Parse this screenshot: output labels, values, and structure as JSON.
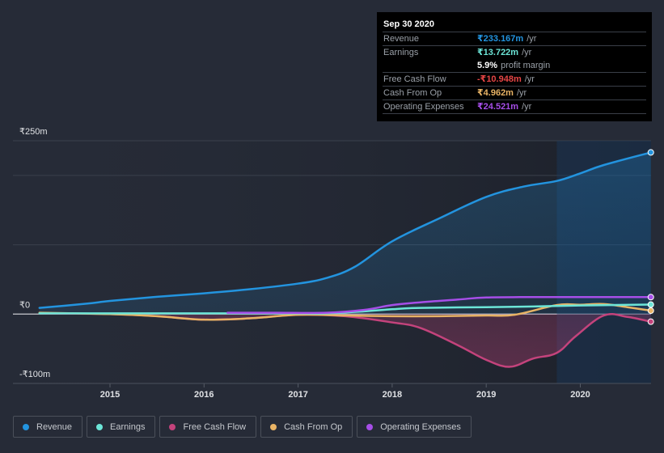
{
  "tooltip": {
    "date": "Sep 30 2020",
    "rows": [
      {
        "label": "Revenue",
        "value": "₹233.167m",
        "unit": "/yr",
        "color": "#2394df"
      },
      {
        "label": "Earnings",
        "value": "₹13.722m",
        "unit": "/yr",
        "color": "#6ce5d7"
      },
      {
        "label": "",
        "value": "5.9%",
        "unit": "profit margin",
        "color": "#ffffff"
      },
      {
        "label": "Free Cash Flow",
        "value": "-₹10.948m",
        "unit": "/yr",
        "color": "#e64545"
      },
      {
        "label": "Cash From Op",
        "value": "₹4.962m",
        "unit": "/yr",
        "color": "#e8b365"
      },
      {
        "label": "Operating Expenses",
        "value": "₹24.521m",
        "unit": "/yr",
        "color": "#a64ee8"
      }
    ]
  },
  "legend": [
    {
      "label": "Revenue",
      "color": "#2394df"
    },
    {
      "label": "Earnings",
      "color": "#6ce5d7"
    },
    {
      "label": "Free Cash Flow",
      "color": "#c4437c"
    },
    {
      "label": "Cash From Op",
      "color": "#e8b365"
    },
    {
      "label": "Operating Expenses",
      "color": "#a64ee8"
    }
  ],
  "chart_data": {
    "type": "area",
    "title": "",
    "xlabel": "",
    "ylabel": "",
    "currency": "₹",
    "unit": "m",
    "ylim": [
      -100,
      250
    ],
    "xlim": [
      2014.75,
      2020.75
    ],
    "y_ticks": [
      {
        "value": 250,
        "label": "₹250m"
      },
      {
        "value": 0,
        "label": "₹0"
      },
      {
        "value": -100,
        "label": "-₹100m"
      }
    ],
    "gridlines": [
      250,
      200,
      100,
      0,
      -100
    ],
    "x_ticks": [
      2015,
      2016,
      2017,
      2018,
      2019,
      2020
    ],
    "x_tick_labels": [
      "2015",
      "2016",
      "2017",
      "2018",
      "2019",
      "2020"
    ],
    "highlight_from": 2020.0,
    "series": [
      {
        "name": "Revenue",
        "color": "#2394df",
        "fill": true,
        "points": [
          [
            2014.25,
            9
          ],
          [
            2014.75,
            15
          ],
          [
            2015.0,
            19
          ],
          [
            2015.5,
            25
          ],
          [
            2016.0,
            30
          ],
          [
            2016.5,
            36
          ],
          [
            2017.0,
            44
          ],
          [
            2017.3,
            52
          ],
          [
            2017.6,
            68
          ],
          [
            2018.0,
            105
          ],
          [
            2018.5,
            138
          ],
          [
            2019.0,
            169
          ],
          [
            2019.4,
            184
          ],
          [
            2019.75,
            192
          ],
          [
            2020.0,
            203
          ],
          [
            2020.25,
            215
          ],
          [
            2020.75,
            233.167
          ]
        ]
      },
      {
        "name": "Earnings",
        "color": "#6ce5d7",
        "fill": false,
        "points": [
          [
            2014.25,
            1
          ],
          [
            2015.0,
            1
          ],
          [
            2016.0,
            1
          ],
          [
            2017.0,
            1
          ],
          [
            2017.3,
            1
          ],
          [
            2017.7,
            4
          ],
          [
            2018.0,
            7
          ],
          [
            2018.3,
            9
          ],
          [
            2019.0,
            10
          ],
          [
            2019.5,
            11
          ],
          [
            2020.0,
            12.5
          ],
          [
            2020.75,
            13.722
          ]
        ]
      },
      {
        "name": "Free Cash Flow",
        "color": "#c4437c",
        "fill": true,
        "points": [
          [
            2014.25,
            1
          ],
          [
            2015.0,
            0
          ],
          [
            2015.5,
            -3
          ],
          [
            2016.0,
            -8
          ],
          [
            2016.5,
            -6
          ],
          [
            2017.0,
            -1
          ],
          [
            2017.5,
            -3
          ],
          [
            2018.0,
            -12
          ],
          [
            2018.3,
            -20
          ],
          [
            2018.7,
            -45
          ],
          [
            2019.0,
            -66
          ],
          [
            2019.25,
            -76
          ],
          [
            2019.5,
            -64
          ],
          [
            2019.75,
            -56
          ],
          [
            2019.95,
            -32
          ],
          [
            2020.25,
            -2
          ],
          [
            2020.5,
            -4
          ],
          [
            2020.75,
            -10.948
          ]
        ]
      },
      {
        "name": "Cash From Op",
        "color": "#e8b365",
        "fill": false,
        "points": [
          [
            2014.25,
            2
          ],
          [
            2015.0,
            0
          ],
          [
            2015.5,
            -3
          ],
          [
            2016.0,
            -8
          ],
          [
            2016.5,
            -6
          ],
          [
            2017.0,
            -1
          ],
          [
            2017.5,
            -2
          ],
          [
            2018.0,
            -3
          ],
          [
            2018.5,
            -3
          ],
          [
            2019.0,
            -2
          ],
          [
            2019.3,
            -1
          ],
          [
            2019.75,
            13
          ],
          [
            2020.0,
            13.5
          ],
          [
            2020.25,
            14.5
          ],
          [
            2020.5,
            10
          ],
          [
            2020.75,
            4.962
          ]
        ]
      },
      {
        "name": "Operating Expenses",
        "color": "#a64ee8",
        "fill": false,
        "points": [
          [
            2016.25,
            2
          ],
          [
            2016.75,
            2
          ],
          [
            2017.3,
            2
          ],
          [
            2017.7,
            6
          ],
          [
            2018.0,
            13
          ],
          [
            2018.3,
            17
          ],
          [
            2018.7,
            21
          ],
          [
            2019.0,
            24
          ],
          [
            2019.5,
            24.5
          ],
          [
            2020.0,
            24.5
          ],
          [
            2020.75,
            24.521
          ]
        ]
      }
    ]
  }
}
